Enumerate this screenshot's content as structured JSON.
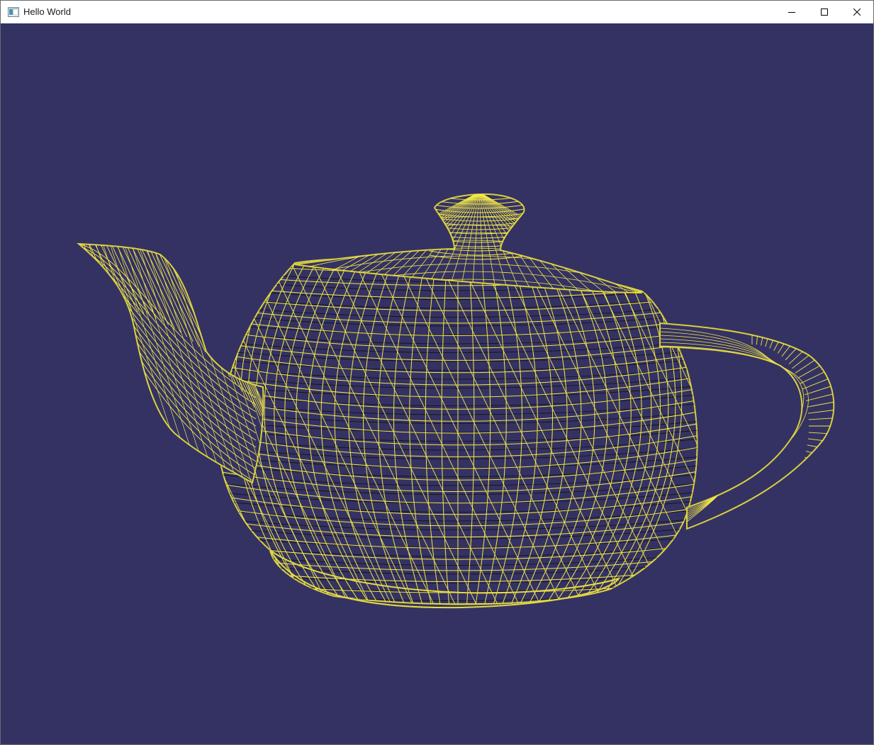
{
  "window": {
    "title": "Hello World",
    "app_icon": "application-window-icon",
    "controls": {
      "minimize_icon": "minimize-icon",
      "maximize_icon": "maximize-icon",
      "close_icon": "close-icon"
    }
  },
  "viewport": {
    "background_color": "#343263",
    "scene": "wireframe-teapot",
    "wire_color": "#f2e84a",
    "shadow_wire_color": "#111111"
  }
}
